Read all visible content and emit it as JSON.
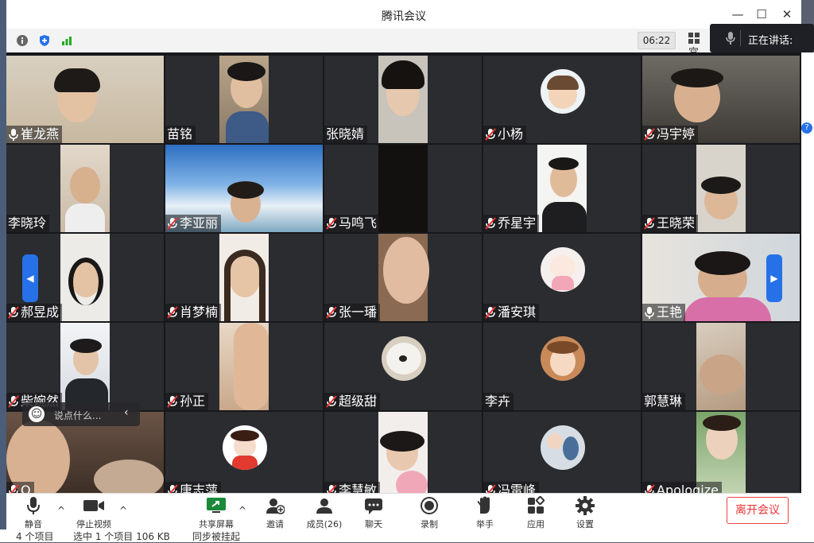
{
  "window": {
    "title": "腾讯会议"
  },
  "infobar": {
    "timer": "06:22",
    "layout_label": "宫"
  },
  "speaking": {
    "label": "正在讲话:"
  },
  "participants": [
    {
      "name": "崔龙燕",
      "mic": "on"
    },
    {
      "name": "苗铭",
      "mic": "none"
    },
    {
      "name": "张晓婧",
      "mic": "none"
    },
    {
      "name": "小杨",
      "mic": "muted"
    },
    {
      "name": "冯宇婷",
      "mic": "muted"
    },
    {
      "name": "李晓玲",
      "mic": "none"
    },
    {
      "name": "李亚丽",
      "mic": "muted"
    },
    {
      "name": "马鸣飞",
      "mic": "muted"
    },
    {
      "name": "乔星宇",
      "mic": "muted"
    },
    {
      "name": "王晓荣",
      "mic": "muted"
    },
    {
      "name": "郝昱成",
      "mic": "muted"
    },
    {
      "name": "肖梦楠",
      "mic": "muted"
    },
    {
      "name": "张一璠",
      "mic": "muted"
    },
    {
      "name": "潘安琪",
      "mic": "muted"
    },
    {
      "name": "王艳",
      "mic": "on"
    },
    {
      "name": "柴婉然",
      "mic": "muted"
    },
    {
      "name": "孙正",
      "mic": "muted"
    },
    {
      "name": "超级甜",
      "mic": "muted"
    },
    {
      "name": "李卉",
      "mic": "none"
    },
    {
      "name": "郭慧琳",
      "mic": "none"
    },
    {
      "name": "Q",
      "mic": "muted"
    },
    {
      "name": "唐志萍",
      "mic": "muted"
    },
    {
      "name": "李慧敏",
      "mic": "muted"
    },
    {
      "name": "冯雷峰",
      "mic": "muted"
    },
    {
      "name": "Apologize",
      "mic": "muted"
    }
  ],
  "chat": {
    "placeholder": "说点什么..."
  },
  "toolbar": {
    "mute": "静音",
    "stop_video": "停止视频",
    "share_screen": "共享屏幕",
    "invite": "邀请",
    "members": "成员(26)",
    "chat": "聊天",
    "record": "录制",
    "raise_hand": "举手",
    "apps": "应用",
    "settings": "设置",
    "leave": "离开会议"
  },
  "explorer_status": {
    "items": "4 个项目",
    "selected": "选中 1 个项目 106 KB",
    "sync": "同步被挂起"
  },
  "colors": {
    "accent_blue": "#2671e8",
    "leave_red": "#e33333",
    "grid_bg": "#17181b",
    "tile_bg": "#2b2c30"
  }
}
